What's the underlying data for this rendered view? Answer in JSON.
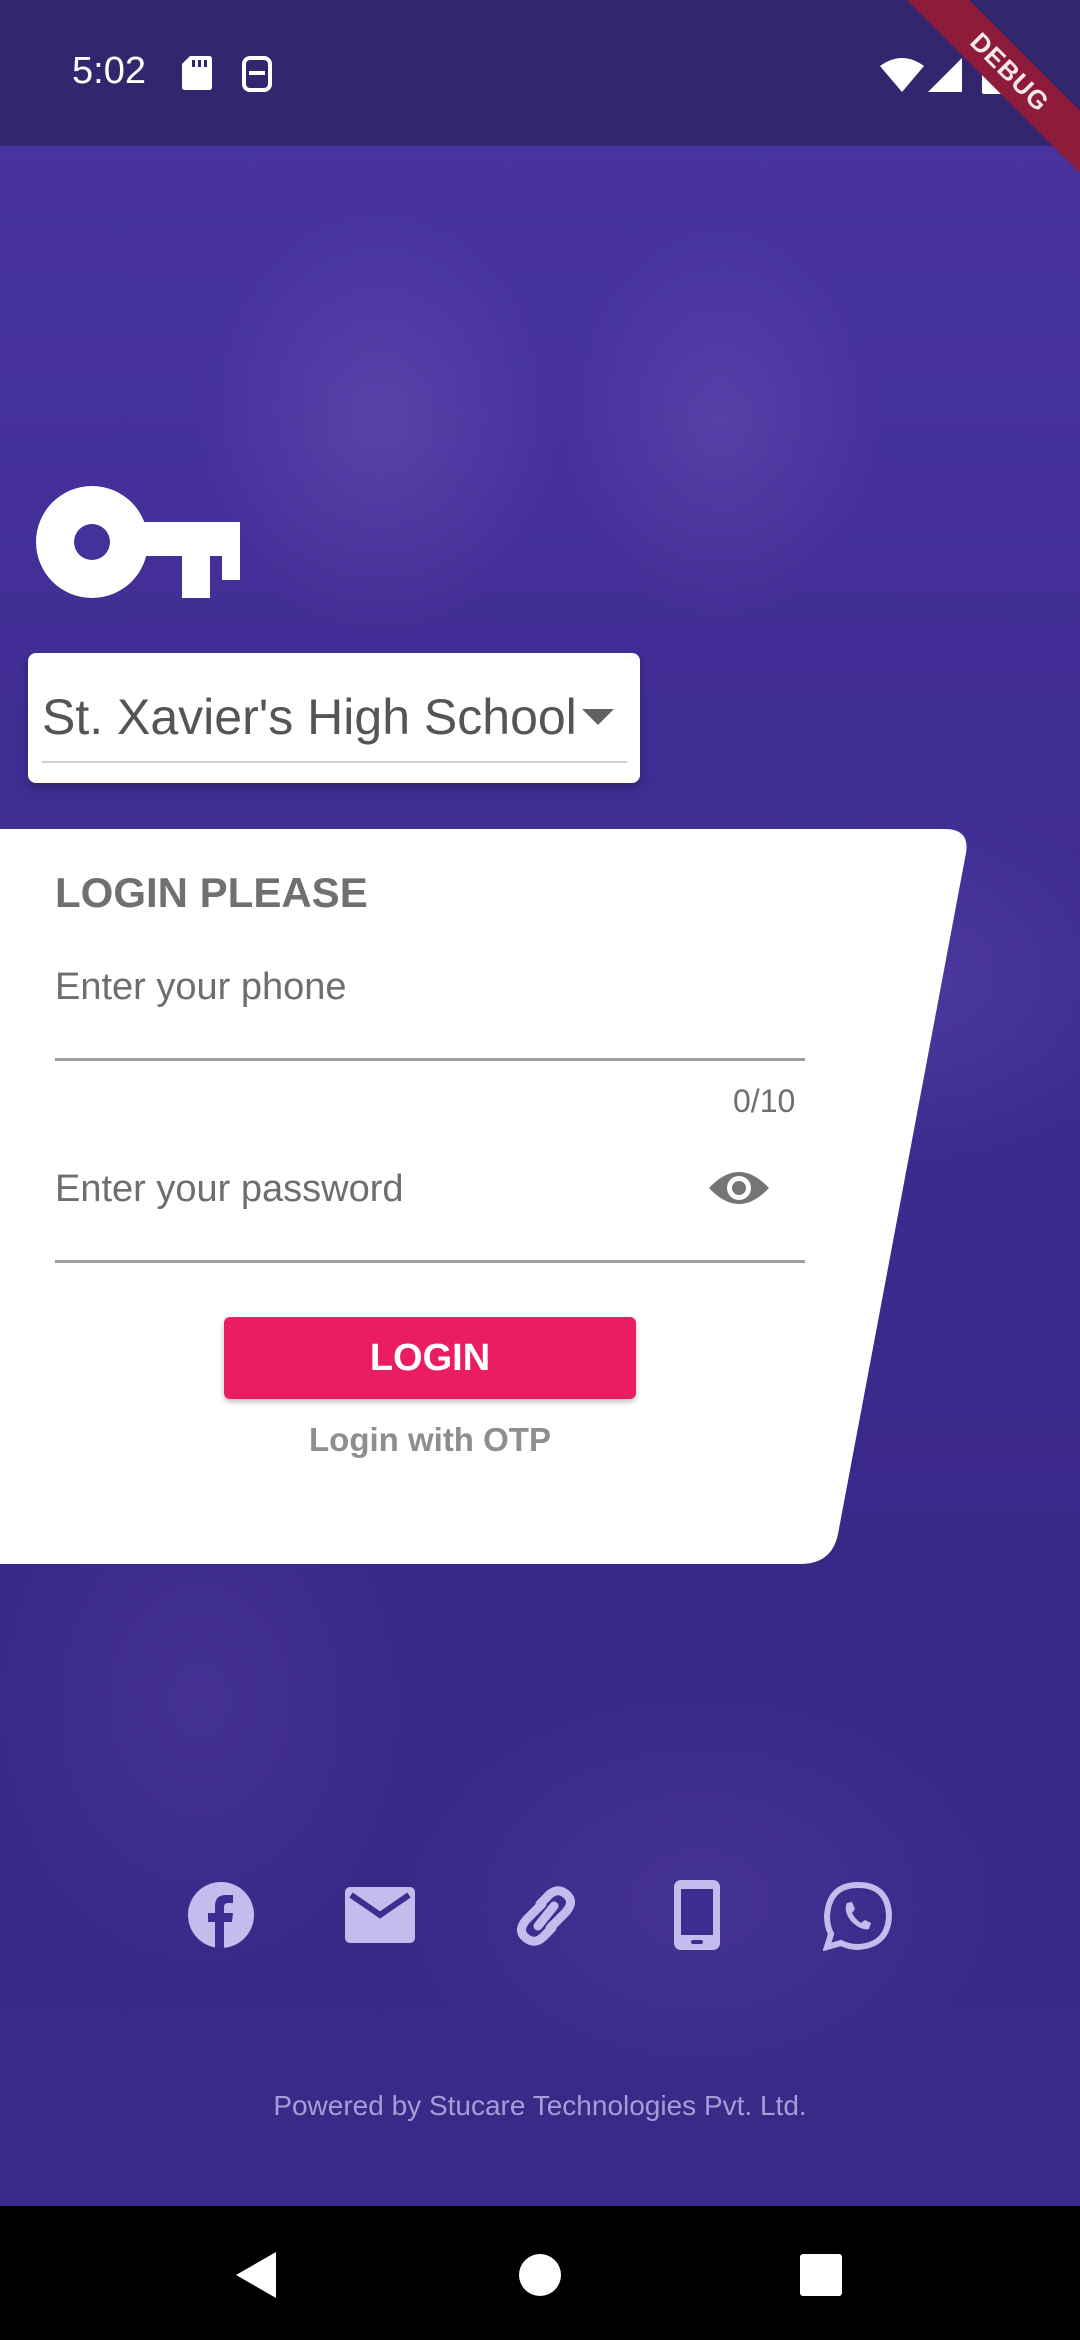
{
  "status_bar": {
    "time": "5:02",
    "icons": [
      "sd-card-icon",
      "no-sim-icon",
      "wifi-icon",
      "signal-icon",
      "battery-icon"
    ],
    "debug_banner": "DEBUG"
  },
  "school_select": {
    "selected": "St. Xavier's High School"
  },
  "login_card": {
    "title": "LOGIN PLEASE",
    "phone_placeholder": "Enter your phone",
    "phone_counter": "0/10",
    "password_placeholder": "Enter your password",
    "login_button": "LOGIN",
    "otp_link": "Login with OTP"
  },
  "social_icons": [
    "facebook-icon",
    "mail-icon",
    "link-icon",
    "phone-icon",
    "whatsapp-icon"
  ],
  "footer": {
    "powered_by": "Powered by Stucare Technologies Pvt. Ltd."
  },
  "colors": {
    "background": "#3d2b8d",
    "status_bar": "#33266f",
    "accent": "#ea1c62",
    "social_icon": "#c4bcec"
  }
}
